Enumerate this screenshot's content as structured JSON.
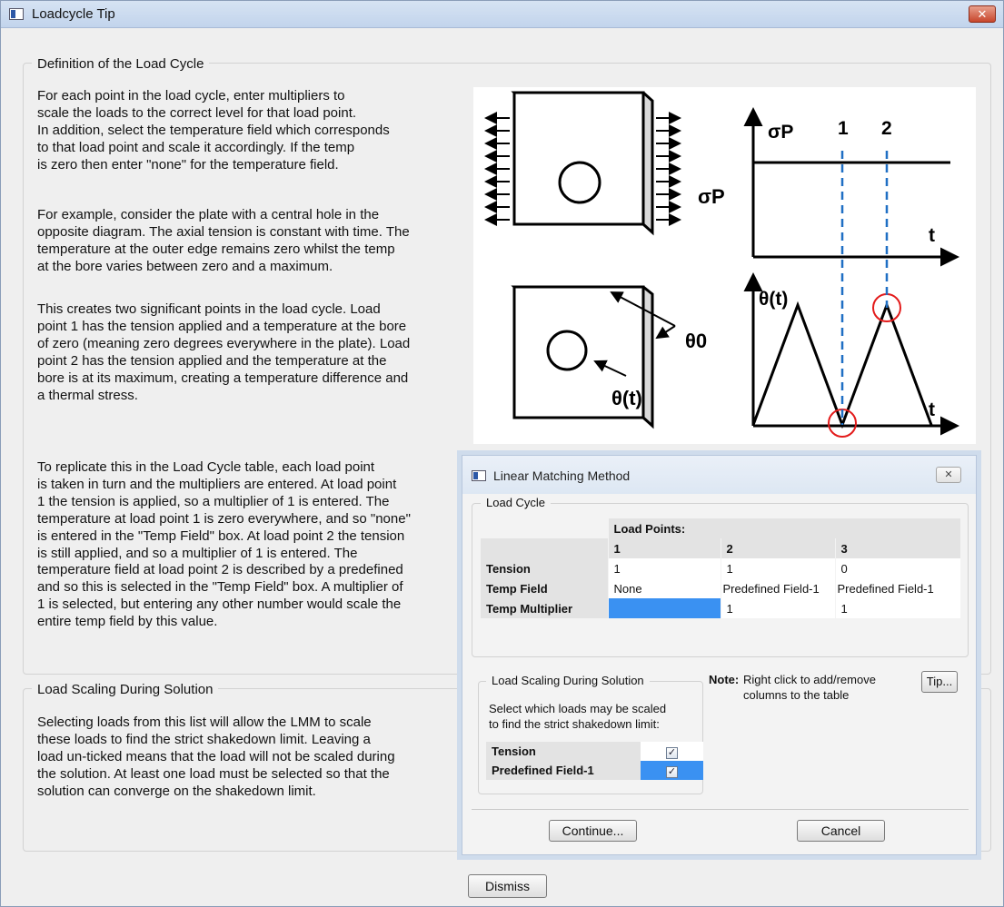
{
  "window": {
    "title": "Loadcycle Tip",
    "close_label": "✕"
  },
  "definition": {
    "legend": "Definition of the Load Cycle",
    "para1": "For each point in the load cycle, enter multipliers to\nscale the loads to the correct level for that load point.\nIn addition, select the temperature field which corresponds\nto that load point and scale it accordingly. If the temp\nis zero then enter \"none\" for the temperature field.",
    "para2": "For example, consider the plate with a central hole in the\nopposite diagram. The axial tension is constant with time. The\ntemperature at the outer edge remains zero whilst the temp\nat the bore varies between zero and a maximum.",
    "para3": "This creates two significant points in the load cycle. Load\npoint 1 has the tension applied and a temperature at the bore\nof zero (meaning zero degrees everywhere in the plate). Load\npoint 2 has the tension applied and the temperature at the\nbore is at its maximum, creating a temperature difference and\na thermal stress.",
    "para4": "To replicate this in the Load Cycle table, each load point\nis taken in turn and the multipliers are entered. At load point\n1 the tension is applied, so a multiplier of 1 is entered. The\ntemperature at load point 1 is zero everywhere, and so \"none\"\nis entered in the \"Temp Field\" box. At load point 2 the tension\nis still applied, and so a multiplier of 1 is entered. The\ntemperature field at load point 2 is described by a predefined\nand so this is selected in the \"Temp Field\" box. A multiplier of\n1 is selected, but entering any other number would scale the\nentire temp field by this value."
  },
  "figure": {
    "sigma_p": "σP",
    "theta0": "θ0",
    "theta_t": "θ(t)",
    "t": "t",
    "point1": "1",
    "point2": "2"
  },
  "scaling": {
    "legend": "Load Scaling During Solution",
    "para": "Selecting loads from this list will allow the LMM to scale\nthese loads to find the strict shakedown limit. Leaving a\nload un-ticked means that the load will not be scaled during\nthe solution. At least one load must be selected so that the\nsolution can converge on the shakedown limit."
  },
  "dialog": {
    "title": "Linear Matching Method",
    "close_label": "✕",
    "load_cycle_legend": "Load Cycle",
    "load_points_header": "Load Points:",
    "columns": [
      "1",
      "2",
      "3"
    ],
    "rows": [
      {
        "label": "Tension",
        "values": [
          "1",
          "1",
          "0"
        ]
      },
      {
        "label": "Temp Field",
        "values": [
          "None",
          "Predefined Field-1",
          "Predefined Field-1"
        ]
      },
      {
        "label": "Temp Multiplier",
        "values": [
          "",
          "1",
          "1"
        ]
      }
    ],
    "scaling_legend": "Load Scaling During Solution",
    "scaling_text": "Select which loads may be scaled\nto find the strict shakedown limit:",
    "scaling_items": [
      {
        "label": "Tension",
        "checked": true
      },
      {
        "label": "Predefined Field-1",
        "checked": true
      }
    ],
    "note_label": "Note:",
    "note_text": "Right click to add/remove\ncolumns to the table",
    "tip_button": "Tip...",
    "continue_button": "Continue...",
    "cancel_button": "Cancel"
  },
  "dismiss_button": "Dismiss"
}
